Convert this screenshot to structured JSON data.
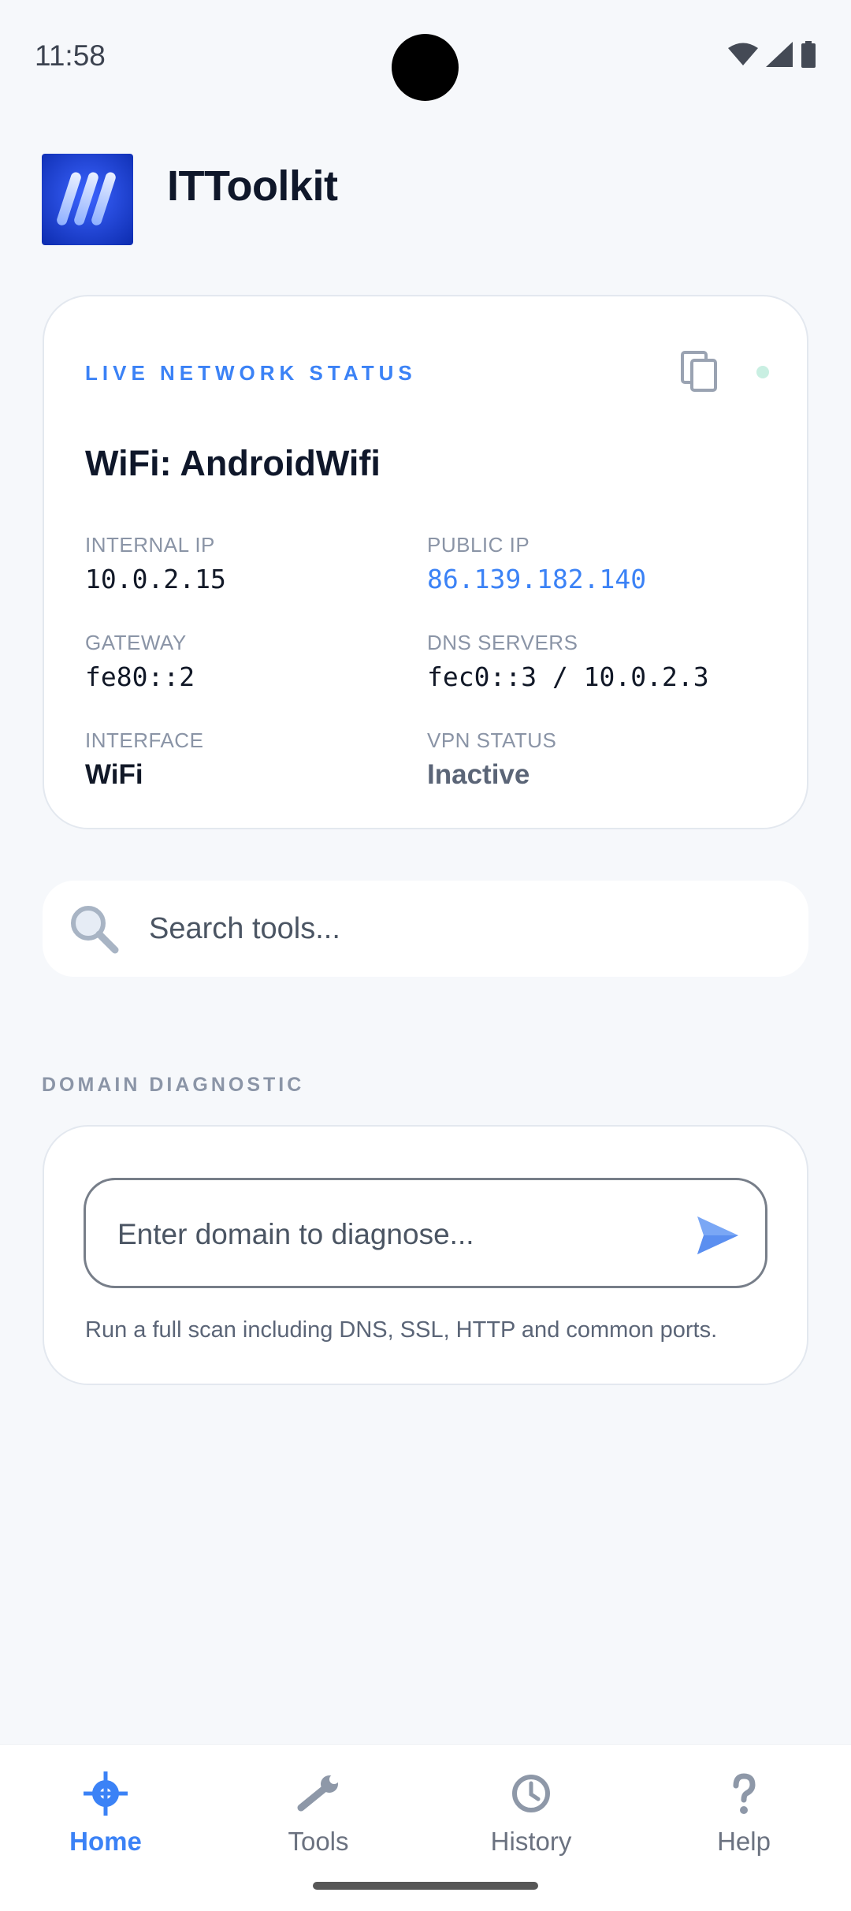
{
  "status_bar": {
    "time": "11:58"
  },
  "app": {
    "title": "ITToolkit"
  },
  "network_card": {
    "label": "LIVE NETWORK STATUS",
    "connection": "WiFi: AndroidWifi",
    "fields": {
      "internal_ip": {
        "label": "INTERNAL IP",
        "value": "10.0.2.15"
      },
      "public_ip": {
        "label": "PUBLIC IP",
        "value": "86.139.182.140"
      },
      "gateway": {
        "label": "GATEWAY",
        "value": "fe80::2"
      },
      "dns": {
        "label": "DNS SERVERS",
        "value": "fec0::3 / 10.0.2.3"
      },
      "interface": {
        "label": "INTERFACE",
        "value": "WiFi"
      },
      "vpn": {
        "label": "VPN STATUS",
        "value": "Inactive"
      }
    }
  },
  "search": {
    "placeholder": "Search tools..."
  },
  "domain_diagnostic": {
    "section_label": "DOMAIN DIAGNOSTIC",
    "input_placeholder": "Enter domain to diagnose...",
    "hint": "Run a full scan including DNS, SSL, HTTP and common ports."
  },
  "bottom_nav": {
    "items": [
      {
        "label": "Home",
        "icon": "crosshair-icon",
        "active": true
      },
      {
        "label": "Tools",
        "icon": "wrench-icon",
        "active": false
      },
      {
        "label": "History",
        "icon": "clock-icon",
        "active": false
      },
      {
        "label": "Help",
        "icon": "question-icon",
        "active": false
      }
    ]
  },
  "colors": {
    "accent": "#3b82f6",
    "background": "#f6f8fb",
    "card": "#ffffff",
    "live_dot": "#c9efe2"
  }
}
